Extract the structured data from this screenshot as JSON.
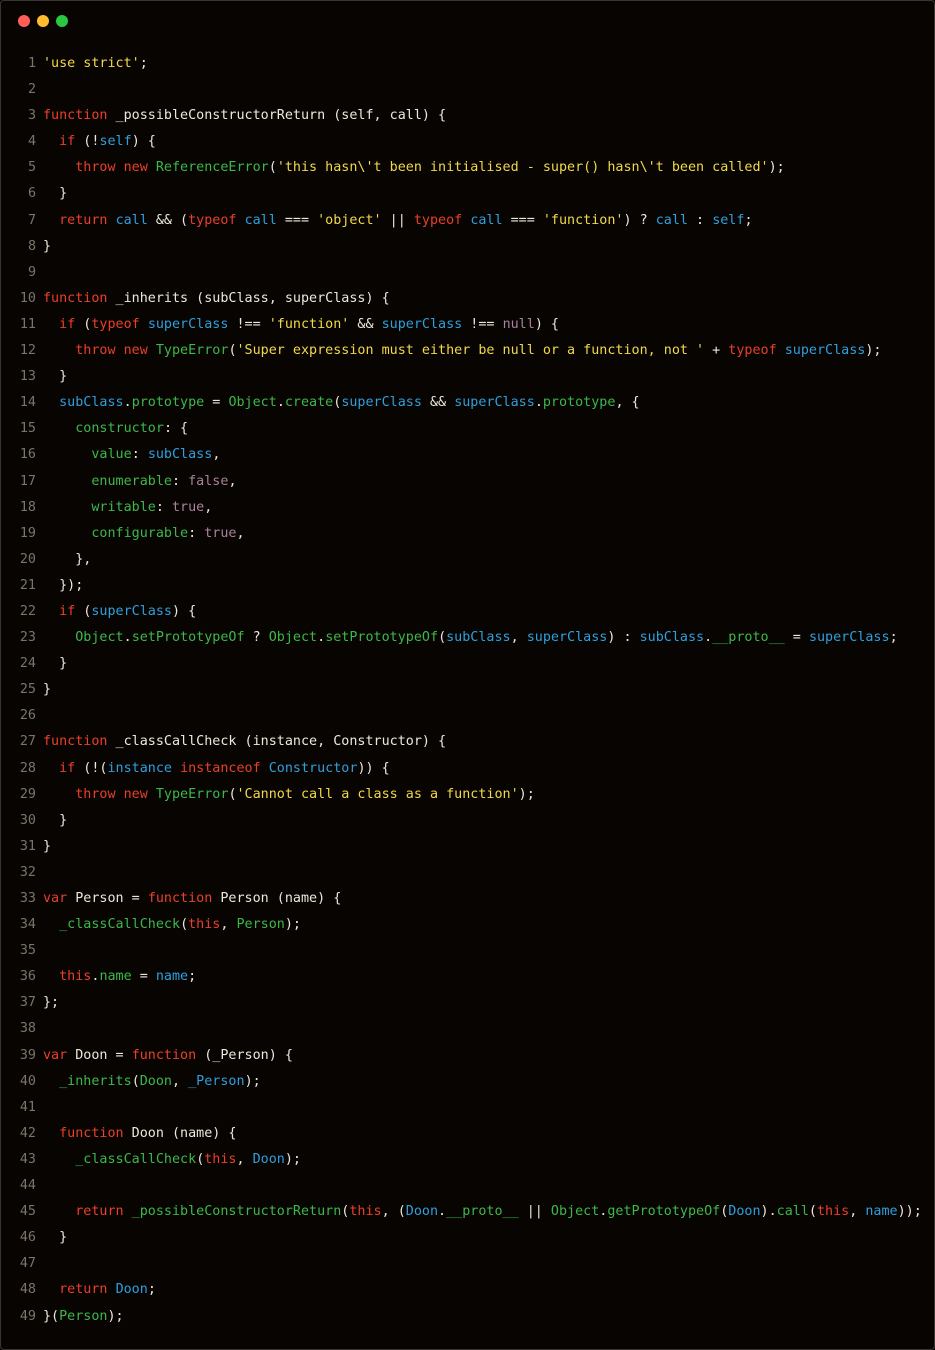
{
  "colors": {
    "background": "#080401",
    "plain": "#ece8dc",
    "keyword": "#e8402a",
    "string": "#f1d94a",
    "identifier": "#2f9fde",
    "class_or_property": "#3cb84a",
    "literal": "#a882a0",
    "line_number": "#7c7468"
  },
  "window_controls": [
    "close",
    "minimize",
    "maximize"
  ],
  "lines": [
    {
      "n": "1",
      "tokens": [
        [
          "str",
          "'use strict'"
        ],
        [
          "pl",
          ";"
        ]
      ]
    },
    {
      "n": "2",
      "tokens": []
    },
    {
      "n": "3",
      "tokens": [
        [
          "kw",
          "function"
        ],
        [
          "pl",
          " _possibleConstructorReturn (self, call) {"
        ]
      ]
    },
    {
      "n": "4",
      "tokens": [
        [
          "pl",
          "  "
        ],
        [
          "kw",
          "if"
        ],
        [
          "pl",
          " (!"
        ],
        [
          "id",
          "self"
        ],
        [
          "pl",
          ") {"
        ]
      ]
    },
    {
      "n": "5",
      "tokens": [
        [
          "pl",
          "    "
        ],
        [
          "kw",
          "throw"
        ],
        [
          "pl",
          " "
        ],
        [
          "kw",
          "new"
        ],
        [
          "pl",
          " "
        ],
        [
          "cl",
          "ReferenceError"
        ],
        [
          "pl",
          "("
        ],
        [
          "str",
          "'this hasn\\'t been initialised - super() hasn\\'t been called'"
        ],
        [
          "pl",
          ");"
        ]
      ]
    },
    {
      "n": "6",
      "tokens": [
        [
          "pl",
          "  }"
        ]
      ]
    },
    {
      "n": "7",
      "tokens": [
        [
          "pl",
          "  "
        ],
        [
          "kw",
          "return"
        ],
        [
          "pl",
          " "
        ],
        [
          "id",
          "call"
        ],
        [
          "pl",
          " && ("
        ],
        [
          "kw",
          "typeof"
        ],
        [
          "pl",
          " "
        ],
        [
          "id",
          "call"
        ],
        [
          "pl",
          " === "
        ],
        [
          "str",
          "'object'"
        ],
        [
          "pl",
          " || "
        ],
        [
          "kw",
          "typeof"
        ],
        [
          "pl",
          " "
        ],
        [
          "id",
          "call"
        ],
        [
          "pl",
          " === "
        ],
        [
          "str",
          "'function'"
        ],
        [
          "pl",
          ") ? "
        ],
        [
          "id",
          "call"
        ],
        [
          "pl",
          " : "
        ],
        [
          "id",
          "self"
        ],
        [
          "pl",
          ";"
        ]
      ]
    },
    {
      "n": "8",
      "tokens": [
        [
          "pl",
          "}"
        ]
      ]
    },
    {
      "n": "9",
      "tokens": []
    },
    {
      "n": "10",
      "tokens": [
        [
          "kw",
          "function"
        ],
        [
          "pl",
          " _inherits (subClass, superClass) {"
        ]
      ]
    },
    {
      "n": "11",
      "tokens": [
        [
          "pl",
          "  "
        ],
        [
          "kw",
          "if"
        ],
        [
          "pl",
          " ("
        ],
        [
          "kw",
          "typeof"
        ],
        [
          "pl",
          " "
        ],
        [
          "id",
          "superClass"
        ],
        [
          "pl",
          " !== "
        ],
        [
          "str",
          "'function'"
        ],
        [
          "pl",
          " && "
        ],
        [
          "id",
          "superClass"
        ],
        [
          "pl",
          " !== "
        ],
        [
          "lit",
          "null"
        ],
        [
          "pl",
          ") {"
        ]
      ]
    },
    {
      "n": "12",
      "tokens": [
        [
          "pl",
          "    "
        ],
        [
          "kw",
          "throw"
        ],
        [
          "pl",
          " "
        ],
        [
          "kw",
          "new"
        ],
        [
          "pl",
          " "
        ],
        [
          "cl",
          "TypeError"
        ],
        [
          "pl",
          "("
        ],
        [
          "str",
          "'Super expression must either be null or a function, not '"
        ],
        [
          "pl",
          " + "
        ],
        [
          "kw",
          "typeof"
        ],
        [
          "pl",
          " "
        ],
        [
          "id",
          "superClass"
        ],
        [
          "pl",
          ");"
        ]
      ]
    },
    {
      "n": "13",
      "tokens": [
        [
          "pl",
          "  }"
        ]
      ]
    },
    {
      "n": "14",
      "tokens": [
        [
          "pl",
          "  "
        ],
        [
          "id",
          "subClass"
        ],
        [
          "pl",
          "."
        ],
        [
          "cl",
          "prototype"
        ],
        [
          "pl",
          " = "
        ],
        [
          "cl",
          "Object"
        ],
        [
          "pl",
          "."
        ],
        [
          "cl",
          "create"
        ],
        [
          "pl",
          "("
        ],
        [
          "id",
          "superClass"
        ],
        [
          "pl",
          " && "
        ],
        [
          "id",
          "superClass"
        ],
        [
          "pl",
          "."
        ],
        [
          "cl",
          "prototype"
        ],
        [
          "pl",
          ", {"
        ]
      ]
    },
    {
      "n": "15",
      "tokens": [
        [
          "pl",
          "    "
        ],
        [
          "cl",
          "constructor"
        ],
        [
          "pl",
          ": {"
        ]
      ]
    },
    {
      "n": "16",
      "tokens": [
        [
          "pl",
          "      "
        ],
        [
          "cl",
          "value"
        ],
        [
          "pl",
          ": "
        ],
        [
          "id",
          "subClass"
        ],
        [
          "pl",
          ","
        ]
      ]
    },
    {
      "n": "17",
      "tokens": [
        [
          "pl",
          "      "
        ],
        [
          "cl",
          "enumerable"
        ],
        [
          "pl",
          ": "
        ],
        [
          "lit",
          "false"
        ],
        [
          "pl",
          ","
        ]
      ]
    },
    {
      "n": "18",
      "tokens": [
        [
          "pl",
          "      "
        ],
        [
          "cl",
          "writable"
        ],
        [
          "pl",
          ": "
        ],
        [
          "lit",
          "true"
        ],
        [
          "pl",
          ","
        ]
      ]
    },
    {
      "n": "19",
      "tokens": [
        [
          "pl",
          "      "
        ],
        [
          "cl",
          "configurable"
        ],
        [
          "pl",
          ": "
        ],
        [
          "lit",
          "true"
        ],
        [
          "pl",
          ","
        ]
      ]
    },
    {
      "n": "20",
      "tokens": [
        [
          "pl",
          "    },"
        ]
      ]
    },
    {
      "n": "21",
      "tokens": [
        [
          "pl",
          "  });"
        ]
      ]
    },
    {
      "n": "22",
      "tokens": [
        [
          "pl",
          "  "
        ],
        [
          "kw",
          "if"
        ],
        [
          "pl",
          " ("
        ],
        [
          "id",
          "superClass"
        ],
        [
          "pl",
          ") {"
        ]
      ]
    },
    {
      "n": "23",
      "tokens": [
        [
          "pl",
          "    "
        ],
        [
          "cl",
          "Object"
        ],
        [
          "pl",
          "."
        ],
        [
          "cl",
          "setPrototypeOf"
        ],
        [
          "pl",
          " ? "
        ],
        [
          "cl",
          "Object"
        ],
        [
          "pl",
          "."
        ],
        [
          "cl",
          "setPrototypeOf"
        ],
        [
          "pl",
          "("
        ],
        [
          "id",
          "subClass"
        ],
        [
          "pl",
          ", "
        ],
        [
          "id",
          "superClass"
        ],
        [
          "pl",
          ") : "
        ],
        [
          "id",
          "subClass"
        ],
        [
          "pl",
          "."
        ],
        [
          "cl",
          "__proto__"
        ],
        [
          "pl",
          " = "
        ],
        [
          "id",
          "superClass"
        ],
        [
          "pl",
          ";"
        ]
      ]
    },
    {
      "n": "24",
      "tokens": [
        [
          "pl",
          "  }"
        ]
      ]
    },
    {
      "n": "25",
      "tokens": [
        [
          "pl",
          "}"
        ]
      ]
    },
    {
      "n": "26",
      "tokens": []
    },
    {
      "n": "27",
      "tokens": [
        [
          "kw",
          "function"
        ],
        [
          "pl",
          " _classCallCheck (instance, Constructor) {"
        ]
      ]
    },
    {
      "n": "28",
      "tokens": [
        [
          "pl",
          "  "
        ],
        [
          "kw",
          "if"
        ],
        [
          "pl",
          " (!("
        ],
        [
          "id",
          "instance"
        ],
        [
          "pl",
          " "
        ],
        [
          "kw",
          "instanceof"
        ],
        [
          "pl",
          " "
        ],
        [
          "id",
          "Constructor"
        ],
        [
          "pl",
          ")) {"
        ]
      ]
    },
    {
      "n": "29",
      "tokens": [
        [
          "pl",
          "    "
        ],
        [
          "kw",
          "throw"
        ],
        [
          "pl",
          " "
        ],
        [
          "kw",
          "new"
        ],
        [
          "pl",
          " "
        ],
        [
          "cl",
          "TypeError"
        ],
        [
          "pl",
          "("
        ],
        [
          "str",
          "'Cannot call a class as a function'"
        ],
        [
          "pl",
          ");"
        ]
      ]
    },
    {
      "n": "30",
      "tokens": [
        [
          "pl",
          "  }"
        ]
      ]
    },
    {
      "n": "31",
      "tokens": [
        [
          "pl",
          "}"
        ]
      ]
    },
    {
      "n": "32",
      "tokens": []
    },
    {
      "n": "33",
      "tokens": [
        [
          "kw",
          "var"
        ],
        [
          "pl",
          " Person = "
        ],
        [
          "kw",
          "function"
        ],
        [
          "pl",
          " Person (name) {"
        ]
      ]
    },
    {
      "n": "34",
      "tokens": [
        [
          "pl",
          "  "
        ],
        [
          "cl",
          "_classCallCheck"
        ],
        [
          "pl",
          "("
        ],
        [
          "kw",
          "this"
        ],
        [
          "pl",
          ", "
        ],
        [
          "cl",
          "Person"
        ],
        [
          "pl",
          ");"
        ]
      ]
    },
    {
      "n": "35",
      "tokens": []
    },
    {
      "n": "36",
      "tokens": [
        [
          "pl",
          "  "
        ],
        [
          "kw",
          "this"
        ],
        [
          "pl",
          "."
        ],
        [
          "cl",
          "name"
        ],
        [
          "pl",
          " = "
        ],
        [
          "id",
          "name"
        ],
        [
          "pl",
          ";"
        ]
      ]
    },
    {
      "n": "37",
      "tokens": [
        [
          "pl",
          "};"
        ]
      ]
    },
    {
      "n": "38",
      "tokens": []
    },
    {
      "n": "39",
      "tokens": [
        [
          "kw",
          "var"
        ],
        [
          "pl",
          " Doon = "
        ],
        [
          "kw",
          "function"
        ],
        [
          "pl",
          " (_Person) {"
        ]
      ]
    },
    {
      "n": "40",
      "tokens": [
        [
          "pl",
          "  "
        ],
        [
          "cl",
          "_inherits"
        ],
        [
          "pl",
          "("
        ],
        [
          "cl",
          "Doon"
        ],
        [
          "pl",
          ", "
        ],
        [
          "id",
          "_Person"
        ],
        [
          "pl",
          ");"
        ]
      ]
    },
    {
      "n": "41",
      "tokens": []
    },
    {
      "n": "42",
      "tokens": [
        [
          "pl",
          "  "
        ],
        [
          "kw",
          "function"
        ],
        [
          "pl",
          " Doon (name) {"
        ]
      ]
    },
    {
      "n": "43",
      "tokens": [
        [
          "pl",
          "    "
        ],
        [
          "cl",
          "_classCallCheck"
        ],
        [
          "pl",
          "("
        ],
        [
          "kw",
          "this"
        ],
        [
          "pl",
          ", "
        ],
        [
          "id",
          "Doon"
        ],
        [
          "pl",
          ");"
        ]
      ]
    },
    {
      "n": "44",
      "tokens": []
    },
    {
      "n": "45",
      "tokens": [
        [
          "pl",
          "    "
        ],
        [
          "kw",
          "return"
        ],
        [
          "pl",
          " "
        ],
        [
          "cl",
          "_possibleConstructorReturn"
        ],
        [
          "pl",
          "("
        ],
        [
          "kw",
          "this"
        ],
        [
          "pl",
          ", ("
        ],
        [
          "id",
          "Doon"
        ],
        [
          "pl",
          "."
        ],
        [
          "cl",
          "__proto__"
        ],
        [
          "pl",
          " || "
        ],
        [
          "cl",
          "Object"
        ],
        [
          "pl",
          "."
        ],
        [
          "cl",
          "getPrototypeOf"
        ],
        [
          "pl",
          "("
        ],
        [
          "id",
          "Doon"
        ],
        [
          "pl",
          ")."
        ],
        [
          "cl",
          "call"
        ],
        [
          "pl",
          "("
        ],
        [
          "kw",
          "this"
        ],
        [
          "pl",
          ", "
        ],
        [
          "id",
          "name"
        ],
        [
          "pl",
          "));"
        ]
      ]
    },
    {
      "n": "46",
      "tokens": [
        [
          "pl",
          "  }"
        ]
      ]
    },
    {
      "n": "47",
      "tokens": []
    },
    {
      "n": "48",
      "tokens": [
        [
          "pl",
          "  "
        ],
        [
          "kw",
          "return"
        ],
        [
          "pl",
          " "
        ],
        [
          "id",
          "Doon"
        ],
        [
          "pl",
          ";"
        ]
      ]
    },
    {
      "n": "49",
      "tokens": [
        [
          "pl",
          "}("
        ],
        [
          "cl",
          "Person"
        ],
        [
          "pl",
          ");"
        ]
      ]
    }
  ]
}
